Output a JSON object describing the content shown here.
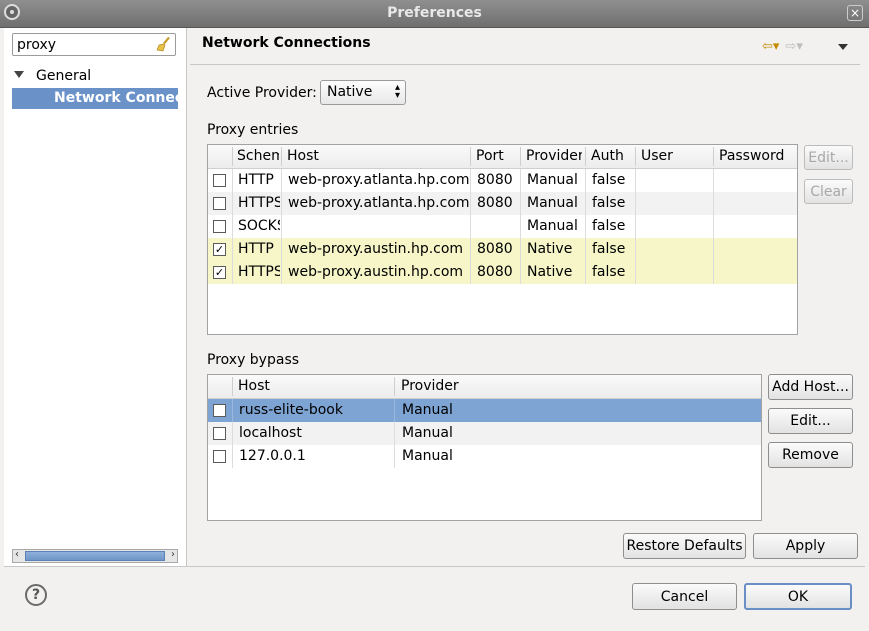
{
  "window": {
    "title": "Preferences",
    "close_glyph": "×"
  },
  "sidebar": {
    "filter_value": "proxy",
    "tree": [
      {
        "label": "General",
        "expanded": true
      },
      {
        "label": "Network Connections",
        "selected": true
      }
    ]
  },
  "page": {
    "title": "Network Connections",
    "active_provider_label": "Active Provider:",
    "active_provider_value": "Native",
    "proxy_entries_label": "Proxy entries",
    "proxy_entries_columns": [
      "Schema",
      "Host",
      "Port",
      "Provider",
      "Auth",
      "User",
      "Password"
    ],
    "proxy_entries_rows": [
      {
        "checked": false,
        "scheme": "HTTP",
        "host": "web-proxy.atlanta.hp.com",
        "port": "8080",
        "provider": "Manual",
        "auth": "false",
        "user": "",
        "password": ""
      },
      {
        "checked": false,
        "scheme": "HTTPS",
        "host": "web-proxy.atlanta.hp.com",
        "port": "8080",
        "provider": "Manual",
        "auth": "false",
        "user": "",
        "password": ""
      },
      {
        "checked": false,
        "scheme": "SOCKS",
        "host": "",
        "port": "",
        "provider": "Manual",
        "auth": "false",
        "user": "",
        "password": ""
      },
      {
        "checked": true,
        "scheme": "HTTP",
        "host": "web-proxy.austin.hp.com",
        "port": "8080",
        "provider": "Native",
        "auth": "false",
        "user": "",
        "password": ""
      },
      {
        "checked": true,
        "scheme": "HTTPS",
        "host": "web-proxy.austin.hp.com",
        "port": "8080",
        "provider": "Native",
        "auth": "false",
        "user": "",
        "password": ""
      }
    ],
    "edit_label": "Edit...",
    "clear_label": "Clear",
    "proxy_bypass_label": "Proxy bypass",
    "bypass_columns": [
      "Host",
      "Provider"
    ],
    "bypass_rows": [
      {
        "checked": false,
        "host": "russ-elite-book",
        "provider": "Manual"
      },
      {
        "checked": false,
        "host": "localhost",
        "provider": "Manual"
      },
      {
        "checked": false,
        "host": "127.0.0.1",
        "provider": "Manual"
      }
    ],
    "add_host_label": "Add Host...",
    "bypass_edit_label": "Edit...",
    "remove_label": "Remove",
    "restore_defaults_label": "Restore Defaults",
    "apply_label": "Apply"
  },
  "footer": {
    "help_glyph": "?",
    "cancel_label": "Cancel",
    "ok_label": "OK"
  },
  "colors": {
    "selection": "#6a92c8",
    "native_row": "#f6f6c8",
    "titlebar": "#7a7a7a"
  }
}
